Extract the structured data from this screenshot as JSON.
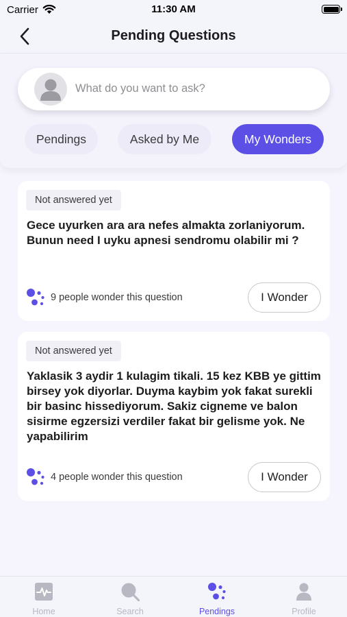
{
  "status_bar": {
    "carrier": "Carrier",
    "time": "11:30 AM"
  },
  "nav": {
    "title": "Pending Questions"
  },
  "search": {
    "placeholder": "What do you want to ask?"
  },
  "tabs": [
    {
      "label": "Pendings",
      "active": false
    },
    {
      "label": "Asked by Me",
      "active": false
    },
    {
      "label": "My Wonders",
      "active": true
    }
  ],
  "questions": [
    {
      "status": "Not answered yet",
      "text": "Gece uyurken ara ara nefes almakta zorlaniyorum.\nBunun need I uyku apnesi sendromu olabilir mi ?",
      "wonder_count": "9 people wonder this question",
      "button_label": "I Wonder"
    },
    {
      "status": "Not answered yet",
      "text": "Yaklasik 3 aydir 1 kulagim tikali. 15 kez KBB ye gittim birsey yok diyorlar. Duyma kaybim yok fakat surekli bir basinc hissediyorum. Sakiz cigneme ve balon sisirme egzersizi verdiler fakat bir gelisme yok. Ne yapabilirim",
      "wonder_count": "4 people wonder this question",
      "button_label": "I Wonder"
    }
  ],
  "tab_bar": [
    {
      "label": "Home",
      "icon": "pulse-icon",
      "active": false
    },
    {
      "label": "Search",
      "icon": "search-icon",
      "active": false
    },
    {
      "label": "Pendings",
      "icon": "pendings-dots-icon",
      "active": true
    },
    {
      "label": "Profile",
      "icon": "profile-icon",
      "active": false
    }
  ],
  "colors": {
    "accent": "#5b4fe6",
    "background": "#f6f5fd",
    "inactive": "#b8b8c2"
  }
}
